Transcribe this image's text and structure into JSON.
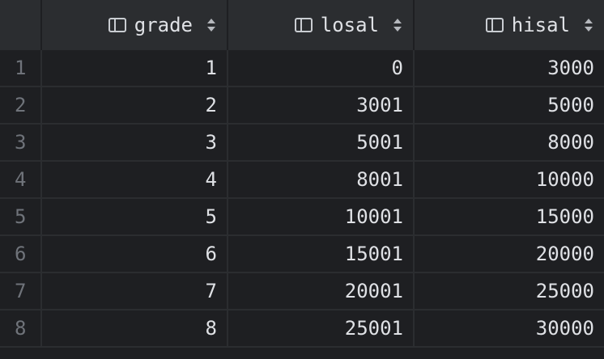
{
  "columns": [
    {
      "name": "grade"
    },
    {
      "name": "losal"
    },
    {
      "name": "hisal"
    }
  ],
  "rows": [
    {
      "num": "1",
      "grade": "1",
      "losal": "0",
      "hisal": "3000"
    },
    {
      "num": "2",
      "grade": "2",
      "losal": "3001",
      "hisal": "5000"
    },
    {
      "num": "3",
      "grade": "3",
      "losal": "5001",
      "hisal": "8000"
    },
    {
      "num": "4",
      "grade": "4",
      "losal": "8001",
      "hisal": "10000"
    },
    {
      "num": "5",
      "grade": "5",
      "losal": "10001",
      "hisal": "15000"
    },
    {
      "num": "6",
      "grade": "6",
      "losal": "15001",
      "hisal": "20000"
    },
    {
      "num": "7",
      "grade": "7",
      "losal": "20001",
      "hisal": "25000"
    },
    {
      "num": "8",
      "grade": "8",
      "losal": "25001",
      "hisal": "30000"
    }
  ],
  "icons": {
    "column": "column-icon",
    "sort": "sort-icon"
  },
  "colors": {
    "background": "#1e1f22",
    "header": "#2b2d30",
    "text": "#dfe1e5",
    "row_number": "#6f737a"
  }
}
